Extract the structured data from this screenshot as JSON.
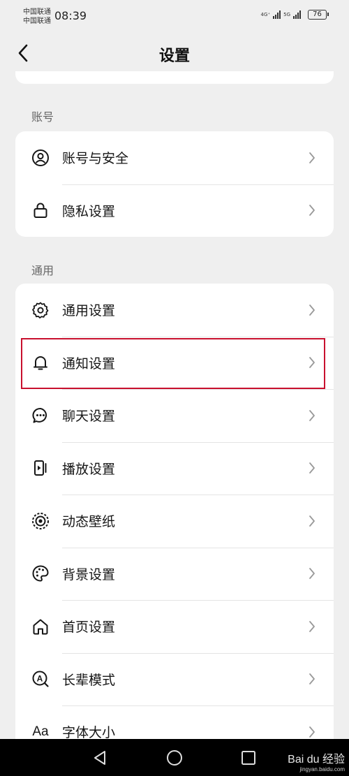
{
  "status": {
    "carrier1": "中国联通",
    "carrier2": "中国联通",
    "time": "08:39",
    "net1": "4G⁺",
    "net2": "5G",
    "battery": "76"
  },
  "header": {
    "title": "设置"
  },
  "sections": {
    "account": {
      "title": "账号",
      "items": [
        {
          "label": "账号与安全",
          "icon": "user-circle-icon"
        },
        {
          "label": "隐私设置",
          "icon": "lock-icon"
        }
      ]
    },
    "general": {
      "title": "通用",
      "items": [
        {
          "label": "通用设置",
          "icon": "gear-icon"
        },
        {
          "label": "通知设置",
          "icon": "bell-icon"
        },
        {
          "label": "聊天设置",
          "icon": "chat-bubble-icon"
        },
        {
          "label": "播放设置",
          "icon": "play-screen-icon"
        },
        {
          "label": "动态壁纸",
          "icon": "dynamic-wallpaper-icon"
        },
        {
          "label": "背景设置",
          "icon": "palette-icon"
        },
        {
          "label": "首页设置",
          "icon": "home-icon"
        },
        {
          "label": "长辈模式",
          "icon": "elder-mode-icon"
        },
        {
          "label": "字体大小",
          "icon_text": "Aa",
          "icon": "font-size-icon"
        }
      ]
    }
  },
  "highlight_color": "#c8102e",
  "watermark": {
    "brand": "Bai du 经验",
    "url": "jingyan.baidu.com"
  }
}
